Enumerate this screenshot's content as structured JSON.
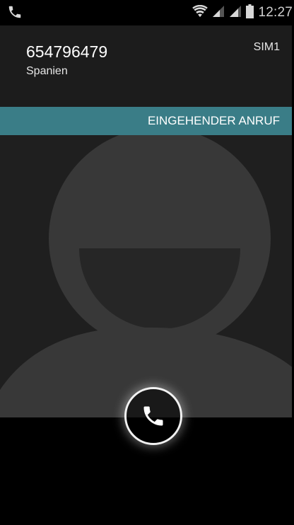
{
  "status_bar": {
    "left_icon": "phone-icon",
    "icons": [
      "wifi-icon",
      "signal-sim1-icon",
      "signal-sim2-icon",
      "battery-icon"
    ],
    "time": "12:27"
  },
  "caller": {
    "number": "654796479",
    "location": "Spanien",
    "sim": "SIM1"
  },
  "call_state": {
    "label": "EINGEHENDER ANRUF"
  },
  "photo": {
    "placeholder_icon": "default-contact-avatar-icon"
  },
  "actions": {
    "answer_icon": "phone-icon"
  },
  "colors": {
    "banner": "#3a7d87",
    "background": "#1e1e1e",
    "avatar": "#3a3a3a"
  }
}
